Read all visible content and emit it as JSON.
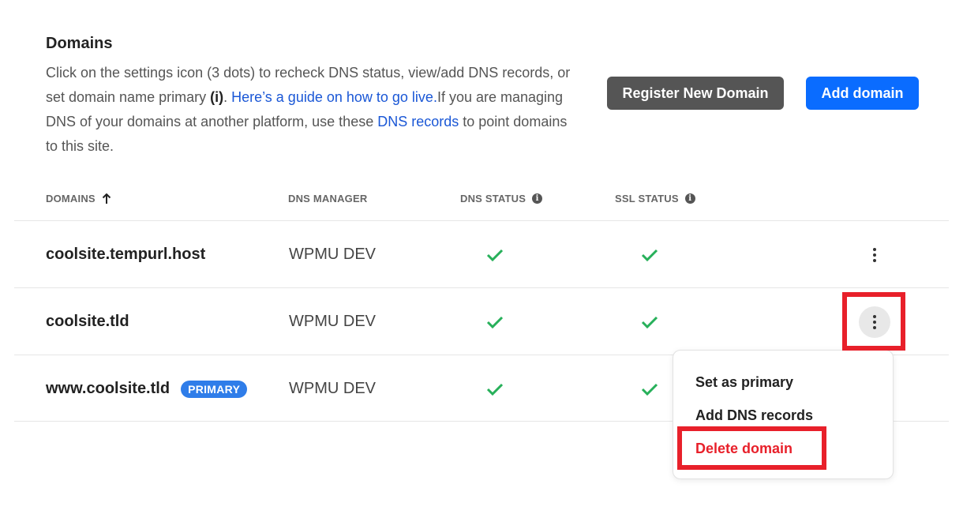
{
  "header": {
    "title": "Domains",
    "desc_part1": "Click on the settings icon (3 dots) to recheck DNS status, view/add DNS records, or set domain name primary ",
    "desc_bold": "(i)",
    "desc_part2": ". ",
    "guide_link": "Here’s a guide on how to go live.",
    "desc_part3": "If you are managing DNS of your domains at another platform, use these ",
    "dns_link": "DNS records",
    "desc_part4": " to point domains to this site."
  },
  "buttons": {
    "register": "Register New Domain",
    "add": "Add domain"
  },
  "table": {
    "columns": {
      "domains": "DOMAINS",
      "dns_manager": "DNS MANAGER",
      "dns_status": "DNS STATUS",
      "ssl_status": "SSL STATUS"
    },
    "rows": [
      {
        "domain": "coolsite.tempurl.host",
        "manager": "WPMU DEV",
        "badge": ""
      },
      {
        "domain": "coolsite.tld",
        "manager": "WPMU DEV",
        "badge": ""
      },
      {
        "domain": "www.coolsite.tld",
        "manager": "WPMU DEV",
        "badge": "PRIMARY"
      }
    ]
  },
  "menu": {
    "set_primary": "Set as primary",
    "add_dns": "Add DNS records",
    "delete": "Delete domain"
  },
  "colors": {
    "accent": "#0a6cff",
    "check": "#27b05a",
    "danger": "#e8202a",
    "badge": "#2f7de9"
  },
  "icons": [
    "sort-up-arrow-icon",
    "info-icon",
    "check-icon",
    "kebab-menu-icon"
  ]
}
